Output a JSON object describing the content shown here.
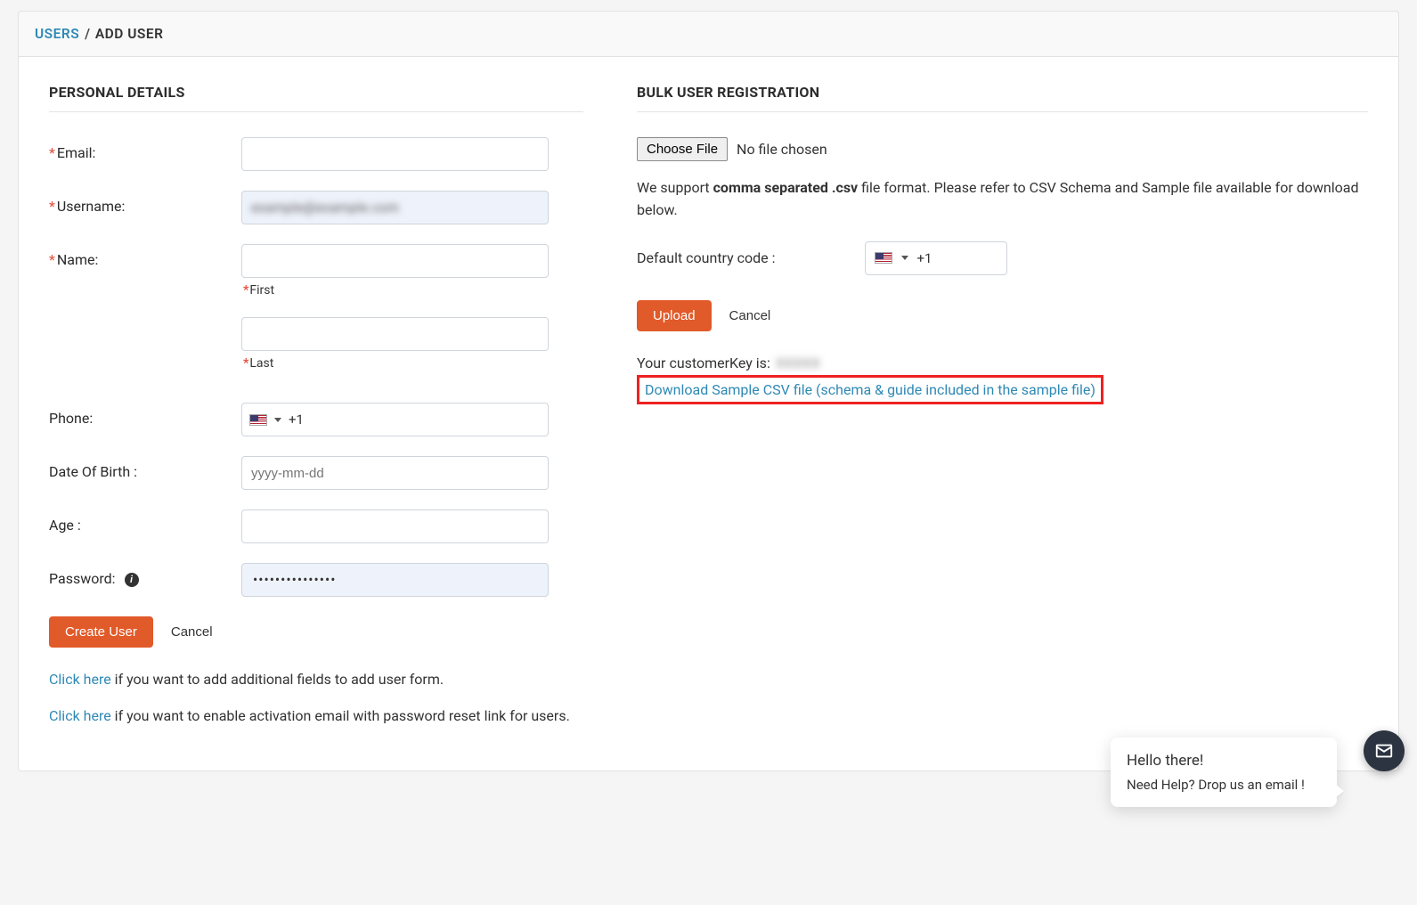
{
  "breadcrumb": {
    "root": "USERS",
    "separator": "/",
    "current": "ADD USER"
  },
  "personal": {
    "title": "PERSONAL DETAILS",
    "labels": {
      "email": "Email:",
      "username": "Username:",
      "name": "Name:",
      "first": "First",
      "last": "Last",
      "phone": "Phone:",
      "dob": "Date Of Birth :",
      "age": "Age :",
      "password": "Password:"
    },
    "values": {
      "email": "",
      "username_masked": "example@example.com",
      "first": "",
      "last": "",
      "phone_code": "+1",
      "dob": "",
      "dob_placeholder": "yyyy-mm-dd",
      "age": "",
      "password_masked": "•••••••••••••••"
    },
    "buttons": {
      "create": "Create User",
      "cancel": "Cancel"
    },
    "help": {
      "click_here": "Click here",
      "line1_rest": " if you want to add additional fields to add user form.",
      "line2_rest": " if you want to enable activation email with password reset link for users."
    }
  },
  "bulk": {
    "title": "BULK USER REGISTRATION",
    "choose_file": "Choose File",
    "no_file": "No file chosen",
    "support_pre": "We support ",
    "support_bold": "comma separated .csv",
    "support_post": " file format. Please refer to CSV Schema and Sample file available for download below.",
    "country_label": "Default country code :",
    "country_code": "+1",
    "upload": "Upload",
    "cancel": "Cancel",
    "ck_label": "Your customerKey is:",
    "ck_value_masked": "XXXXX",
    "download_link": "Download Sample CSV file (schema & guide included in the sample file)"
  },
  "chat": {
    "hello": "Hello there!",
    "help": "Need Help? Drop us an email !"
  }
}
